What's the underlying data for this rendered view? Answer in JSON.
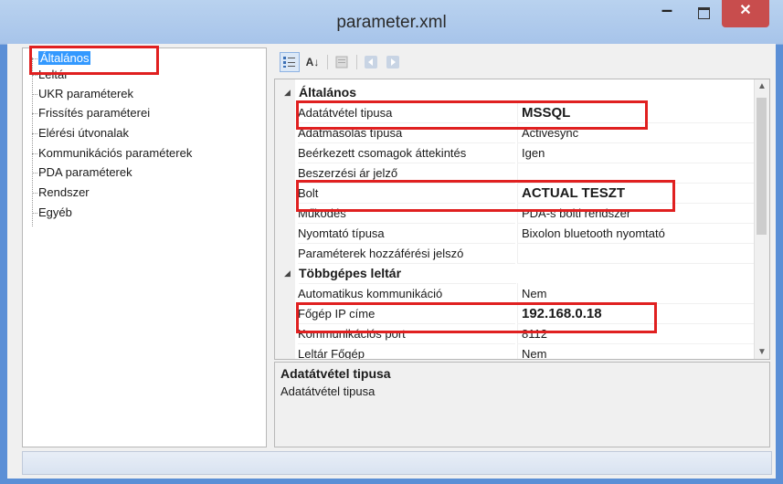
{
  "window": {
    "title": "parameter.xml",
    "minimize": "–",
    "close": "✕"
  },
  "tree": {
    "items": [
      {
        "label": "Általános",
        "selected": true
      },
      {
        "label": "Leltár"
      },
      {
        "label": "UKR paraméterek"
      },
      {
        "label": "Frissítés paraméterei"
      },
      {
        "label": "Elérési útvonalak"
      },
      {
        "label": "Kommunikációs paraméterek"
      },
      {
        "label": "PDA paraméterek"
      },
      {
        "label": "Rendszer"
      },
      {
        "label": "Egyéb"
      }
    ]
  },
  "toolbar": {
    "categorized_icon": "categorized-icon",
    "alphabetical_label": "A↓",
    "property_pages_icon": "property-pages-icon",
    "back_icon": "arrow-left-icon",
    "forward_icon": "arrow-right-icon"
  },
  "grid": {
    "categories": [
      {
        "name": "Általános",
        "rows": [
          {
            "name": "Adatátvétel tipusa",
            "value": "MSSQL",
            "emphasis": true
          },
          {
            "name": "Adatmásolás típusa",
            "value": "Activesync"
          },
          {
            "name": "Beérkezett csomagok áttekintés",
            "value": "Igen"
          },
          {
            "name": "Beszerzési ár jelző",
            "value": ""
          },
          {
            "name": "Bolt",
            "value": "ACTUAL TESZT",
            "emphasis": true
          },
          {
            "name": "Működés",
            "value": "PDA-s bolti rendszer"
          },
          {
            "name": "Nyomtató típusa",
            "value": "Bixolon bluetooth nyomtató"
          },
          {
            "name": "Paraméterek hozzáférési jelszó",
            "value": ""
          }
        ]
      },
      {
        "name": "Többgépes leltár",
        "rows": [
          {
            "name": "Automatikus kommunikáció",
            "value": "Nem"
          },
          {
            "name": "Főgép IP címe",
            "value": "192.168.0.18",
            "emphasis": true
          },
          {
            "name": "Kommunikációs port",
            "value": "8112"
          },
          {
            "name": "Leltár Főgép",
            "value": "Nem"
          }
        ]
      }
    ]
  },
  "description": {
    "title": "Adatátvétel tipusa",
    "text": "Adatátvétel tipusa"
  },
  "colors": {
    "highlight_box": "#e02020",
    "selection": "#3399ff",
    "close_button": "#c84d4d"
  }
}
